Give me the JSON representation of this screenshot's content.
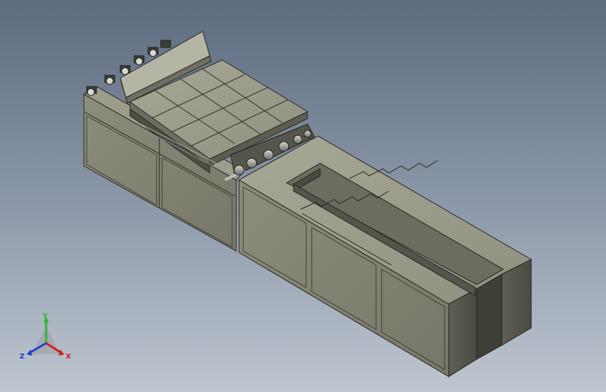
{
  "viewport": {
    "background_top": "#5d6b7f",
    "background_bottom": "#bfc6d0"
  },
  "model": {
    "description_icon": "cad-assembly-conveyor-machine",
    "body_color": "#8a8a78",
    "body_dark": "#5e5e52",
    "body_light": "#a9a995",
    "edge_color": "#2a2a24"
  },
  "triad": {
    "x_label": "X",
    "y_label": "Y",
    "z_label": "Z",
    "x_color": "#d21f1f",
    "y_color": "#2fb52f",
    "z_color": "#1f3fd2"
  }
}
